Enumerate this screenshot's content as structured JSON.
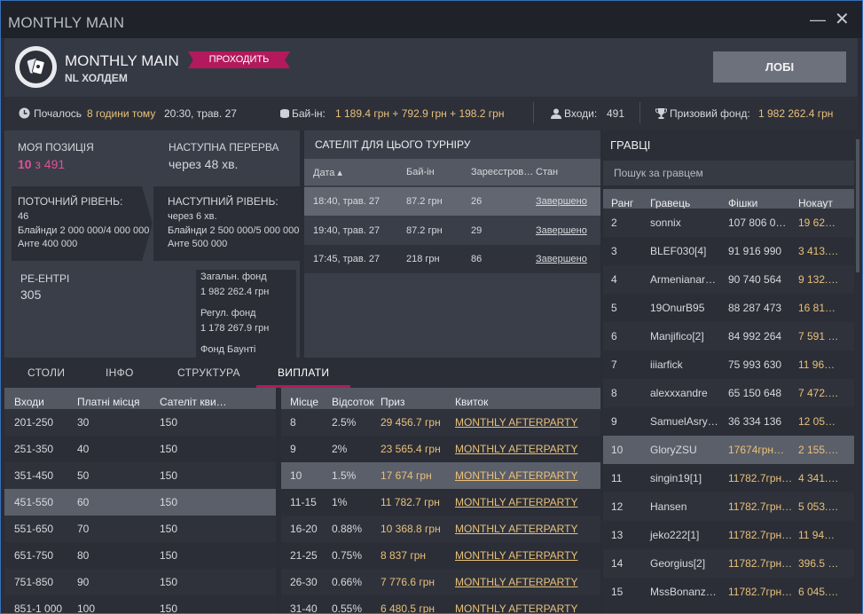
{
  "window": {
    "title": "MONTHLY MAIN"
  },
  "header": {
    "name": "MONTHLY MAIN",
    "game": "NL ХОЛДЕМ",
    "status": "ПРОХОДИТЬ",
    "lobby_button": "ЛОБІ"
  },
  "infobar": {
    "started_label": "Почалось",
    "started_ago": "8 години тому",
    "started_time": "20:30, трав. 27",
    "buyin_label": "Бай-ін:",
    "buyin_value": "1 189.4 грн + 792.9 грн + 198.2 грн",
    "entries_label": "Входи:",
    "entries_value": "491",
    "prize_label": "Призовий фонд:",
    "prize_value": "1 982 262.4 грн"
  },
  "position": {
    "label": "МОЯ ПОЗИЦІЯ",
    "rank": "10",
    "of_label": "з 491"
  },
  "break": {
    "label": "НАСТУПНА ПЕРЕРВА",
    "value": "через 48 хв."
  },
  "current_level": {
    "label": "ПОТОЧНИЙ РІВЕНЬ:",
    "level": "46",
    "blinds": "Блайнди 2 000 000/4 000 000",
    "ante": "Анте 400 000"
  },
  "next_level": {
    "label": "НАСТУПНИЙ РІВЕНЬ:",
    "in": "через 6 хв.",
    "blinds": "Блайнди 2 500 000/5 000 000",
    "ante": "Анте 500 000"
  },
  "reentries": {
    "label": "РЕ-ЕНТРІ",
    "value": "305"
  },
  "funds": {
    "total_label": "Загальн. фонд",
    "total_value": "1 982 262.4 грн",
    "regular_label": "Регул. фонд",
    "regular_value": "1 178 267.9 грн",
    "bounty_label": "Фонд Баунті"
  },
  "satellite": {
    "title": "САТЕЛІТ ДЛЯ ЦЬОГО ТУРНІРУ",
    "headers": [
      "Дата ▴",
      "Бай-ін",
      "Зареєстров…",
      "Стан"
    ],
    "rows": [
      [
        "18:40, трав. 27",
        "87.2 грн",
        "26",
        "Завершено"
      ],
      [
        "19:40, трав. 27",
        "87.2 грн",
        "29",
        "Завершено"
      ],
      [
        "17:45, трав. 27",
        "218 грн",
        "86",
        "Завершено"
      ]
    ]
  },
  "tabs": [
    "СТОЛИ",
    "ІНФО",
    "СТРУКТУРА",
    "ВИПЛАТИ"
  ],
  "entries_table": {
    "headers": [
      "Входи",
      "Платні місця",
      "Сателіт кви…"
    ],
    "rows": [
      [
        "201-250",
        "30",
        "150"
      ],
      [
        "251-350",
        "40",
        "150"
      ],
      [
        "351-450",
        "50",
        "150"
      ],
      [
        "451-550",
        "60",
        "150"
      ],
      [
        "551-650",
        "70",
        "150"
      ],
      [
        "651-750",
        "80",
        "150"
      ],
      [
        "751-850",
        "90",
        "150"
      ],
      [
        "851-1 000",
        "100",
        "150"
      ]
    ]
  },
  "payouts_table": {
    "headers": [
      "Місце",
      "Відсоток",
      "Приз",
      "Квиток"
    ],
    "rows": [
      [
        "8",
        "2.5%",
        "29 456.7 грн",
        "MONTHLY AFTERPARTY"
      ],
      [
        "9",
        "2%",
        "23 565.4 грн",
        "MONTHLY AFTERPARTY"
      ],
      [
        "10",
        "1.5%",
        "17 674 грн",
        "MONTHLY AFTERPARTY"
      ],
      [
        "11-15",
        "1%",
        "11 782.7 грн",
        "MONTHLY AFTERPARTY"
      ],
      [
        "16-20",
        "0.88%",
        "10 368.8 грн",
        "MONTHLY AFTERPARTY"
      ],
      [
        "21-25",
        "0.75%",
        "8 837 грн",
        "MONTHLY AFTERPARTY"
      ],
      [
        "26-30",
        "0.66%",
        "7 776.6 грн",
        "MONTHLY AFTERPARTY"
      ],
      [
        "31-40",
        "0.55%",
        "6 480.5 грн",
        "MONTHLY AFTERPARTY"
      ]
    ]
  },
  "players": {
    "title": "ГРАВЦІ",
    "search_placeholder": "Пошук за гравцем",
    "headers": [
      "Ранг",
      "Гравець",
      "Фішки",
      "Нокаут"
    ],
    "rows": [
      [
        "2",
        "sonnix",
        "107 806 0…",
        "19 62…"
      ],
      [
        "3",
        "BLEF030[4]",
        "91 916 990",
        "3 413.…"
      ],
      [
        "4",
        "Armenianar…",
        "90 740 564",
        "9 132.…"
      ],
      [
        "5",
        "19OnurB95",
        "88 287 473",
        "16 81…"
      ],
      [
        "6",
        "Manjifico[2]",
        "84 992 264",
        "7 591 …"
      ],
      [
        "7",
        "iiiarfick",
        "75 993 630",
        "11 96…"
      ],
      [
        "8",
        "alexxxandre",
        "65 150 648",
        "7 472.…"
      ],
      [
        "9",
        "SamuelAsry…",
        "36 334 136",
        "12 05…"
      ],
      [
        "10",
        "GloryZSU",
        "17674грн…",
        "2 155.…"
      ],
      [
        "11",
        "singin19[1]",
        "11782.7грн…",
        "4 341.…"
      ],
      [
        "12",
        "Hansen",
        "11782.7грн…",
        "5 053.…"
      ],
      [
        "13",
        "jeko222[1]",
        "11782.7грн…",
        "11 94…"
      ],
      [
        "14",
        "Georgius[2]",
        "11782.7грн…",
        "396.5 …"
      ],
      [
        "15",
        "MssBonanz…",
        "11782.7грн…",
        "6 045.…"
      ]
    ]
  },
  "colors": {
    "accent": "#b3195d",
    "gold": "#e9c07a",
    "rank": "#e0509a",
    "green": "#55cc77"
  }
}
